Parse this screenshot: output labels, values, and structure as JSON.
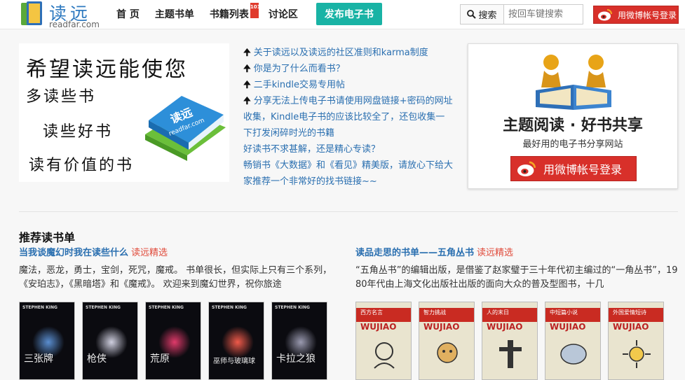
{
  "header": {
    "logo_text": "读远",
    "logo_sub": "readfar.com",
    "nav": [
      {
        "label": "首 页"
      },
      {
        "label": "主题书单"
      },
      {
        "label": "书籍列表",
        "badge": "101"
      },
      {
        "label": "讨论区"
      }
    ],
    "publish_label": "发布电子书",
    "search_button": "搜索",
    "search_placeholder": "按回车键搜索",
    "weibo_login": "用微博帐号登录"
  },
  "banner": {
    "line1": "希望读远能使您",
    "line2": "多读些书",
    "line3": "读些好书",
    "line4": "读有价值的书",
    "book_title": "读远",
    "book_url": "readfar.com"
  },
  "notices": [
    {
      "text": "关于读远以及读远的社区准则和karma制度",
      "pinned": true
    },
    {
      "text": "你是为了什么而看书？",
      "pinned": true
    },
    {
      "text": "二手kindle交易专用帖",
      "pinned": true
    },
    {
      "text": "分享无法上传电子书请使用网盘链接+密码的网址收集，Kindle电子书的应该比较全了，还包收集一下打发闲碎时光的书籍",
      "pinned": true
    },
    {
      "text": "好读书不求甚解，还是精心专读？",
      "pinned": false
    },
    {
      "text": "畅销书《大数据》和《看见》精美版，请放心下给大家推荐一个非常好的找书链接~~",
      "pinned": false
    }
  ],
  "promo": {
    "title": "主题阅读 · 好书共享",
    "subtitle": "最好用的电子书分享网站",
    "weibo_login": "用微博帐号登录"
  },
  "recommend": {
    "section_title": "推荐读书单",
    "lists": [
      {
        "title": "当我谈魔幻时我在读些什么",
        "tag": "读远精选",
        "desc": "魔法，恶龙，勇士，宝剑，死咒，魔戒。 书单很长，但实际上只有三个系列，《安珀志》，《黑暗塔》和《魔戒》。 欢迎来到魔幻世界，祝你旅途",
        "covers": [
          {
            "author": "STEPHEN KING",
            "text": "三张牌",
            "color": "#3a6ea8"
          },
          {
            "author": "STEPHEN KING",
            "text": "枪侠",
            "color": "#b8b8c8"
          },
          {
            "author": "STEPHEN KING",
            "text": "荒原",
            "color": "#c8345a"
          },
          {
            "author": "STEPHEN KING",
            "text": "巫师与玻璃球",
            "color": "#d24a3a"
          },
          {
            "author": "STEPHEN KING",
            "text": "卡拉之狼",
            "color": "#888899"
          }
        ]
      },
      {
        "title": "读品走思的书单——五角丛书",
        "tag": "读远精选",
        "desc": "“五角丛书”的编辑出版，是借鉴了赵家璧于三十年代初主编过的“一角丛书”，1980年代由上海文化出版社出版的面向大众的普及型图书，十几",
        "covers": [
          {
            "series": "WUJIAO",
            "title": "西方名言"
          },
          {
            "series": "WUJIAO",
            "title": "智力挑战"
          },
          {
            "series": "WUJIAO",
            "title": "人的末日"
          },
          {
            "series": "WUJIAO",
            "title": "中短篇小说"
          },
          {
            "series": "WUJIAO",
            "title": "外国爱情短诗"
          }
        ]
      }
    ]
  },
  "colors": {
    "accent_blue": "#2a6fb0",
    "publish_teal": "#19b3a5",
    "weibo_red": "#d8302a",
    "tag_red": "#e04a3a"
  }
}
